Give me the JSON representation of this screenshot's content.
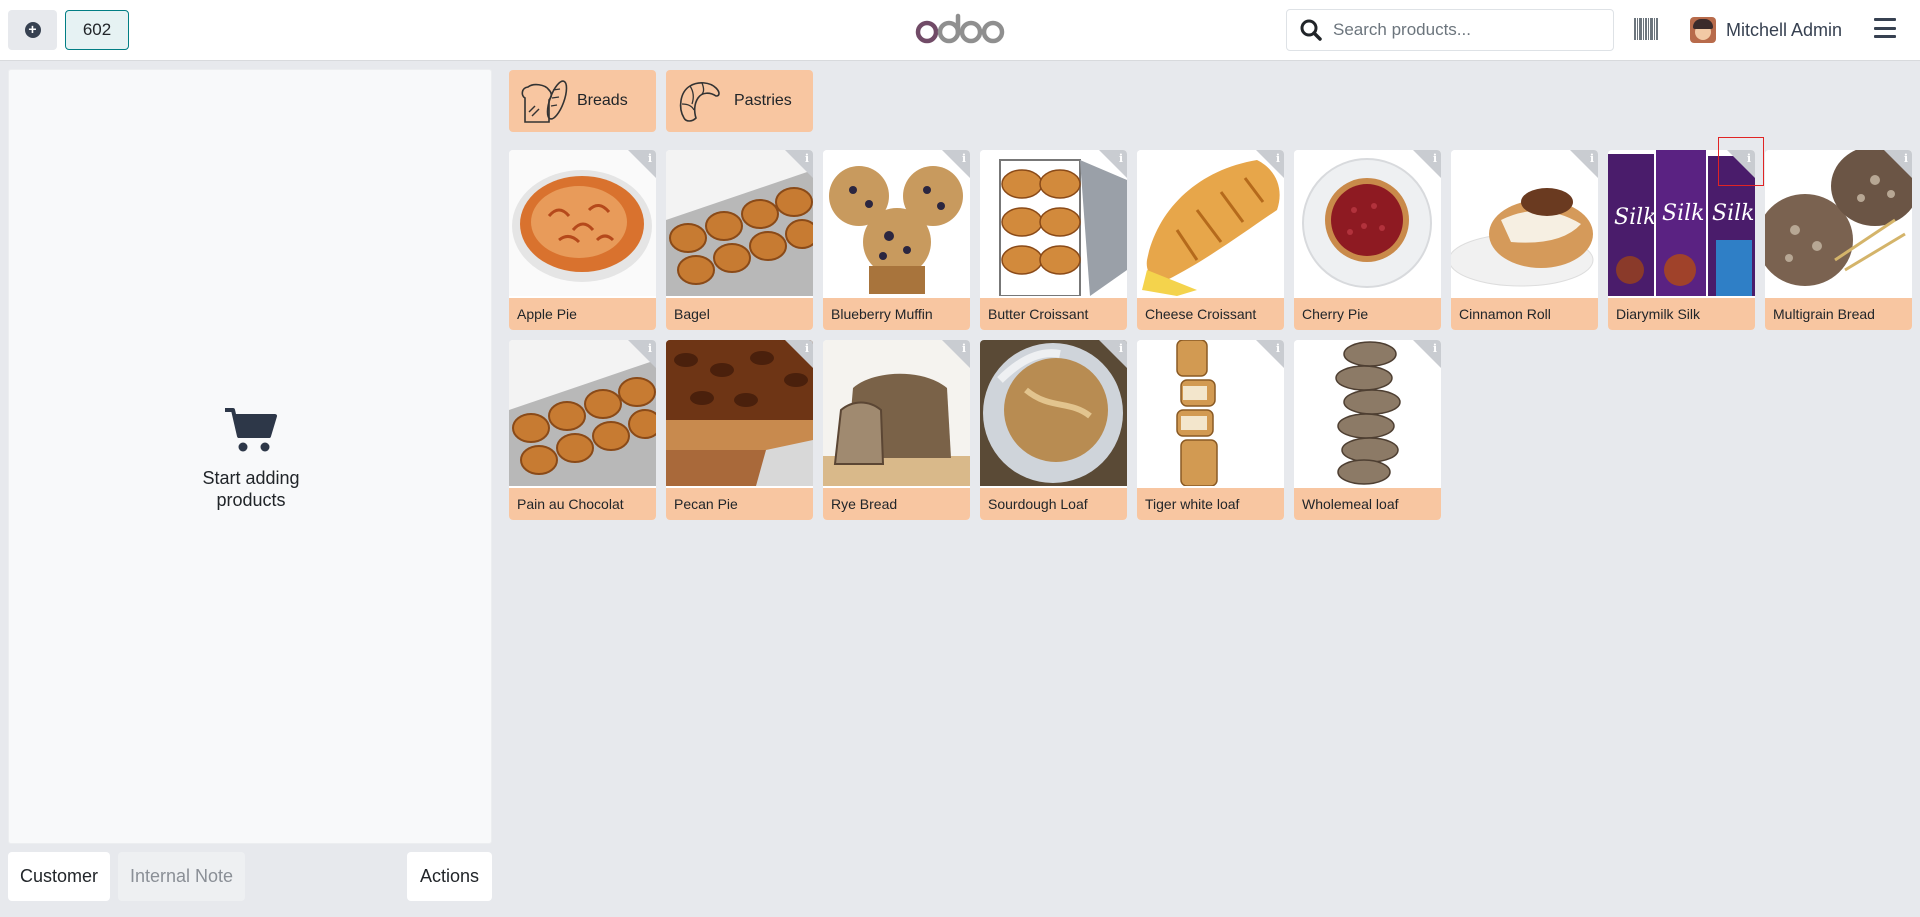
{
  "topbar": {
    "new_order_label": "+",
    "order_number": "602",
    "logo_text": "odoo",
    "search_placeholder": "Search products...",
    "user_name": "Mitchell Admin"
  },
  "order": {
    "empty_message": "Start adding products"
  },
  "bottom_buttons": {
    "customer": "Customer",
    "internal_note": "Internal Note",
    "actions": "Actions"
  },
  "categories": [
    {
      "label": "Breads",
      "icon": "bread-icon"
    },
    {
      "label": "Pastries",
      "icon": "croissant-icon"
    }
  ],
  "products": [
    {
      "name": "Apple Pie",
      "icon": "apple-pie-image"
    },
    {
      "name": "Bagel",
      "icon": "bagel-image"
    },
    {
      "name": "Blueberry Muffin",
      "icon": "muffin-image"
    },
    {
      "name": "Butter Croissant",
      "icon": "croissant-image"
    },
    {
      "name": "Cheese Croissant",
      "icon": "croissant-image"
    },
    {
      "name": "Cherry Pie",
      "icon": "cherry-pie-image"
    },
    {
      "name": "Cinnamon Roll",
      "icon": "cinnamon-roll-image"
    },
    {
      "name": "Diarymilk Silk",
      "icon": "chocolate-bar-image"
    },
    {
      "name": "Multigrain Bread",
      "icon": "bread-loaf-image"
    },
    {
      "name": "Pain au Chocolat",
      "icon": "pastry-tray-image"
    },
    {
      "name": "Pecan Pie",
      "icon": "pecan-pie-image"
    },
    {
      "name": "Rye Bread",
      "icon": "rye-bread-image"
    },
    {
      "name": "Sourdough Loaf",
      "icon": "sourdough-image"
    },
    {
      "name": "Tiger white loaf",
      "icon": "sliced-loaf-image"
    },
    {
      "name": "Wholemeal loaf",
      "icon": "sliced-loaf-image"
    }
  ],
  "colors": {
    "accent": "#017e84",
    "category_bg": "#f8c6a1",
    "brand_purple": "#714b67"
  }
}
